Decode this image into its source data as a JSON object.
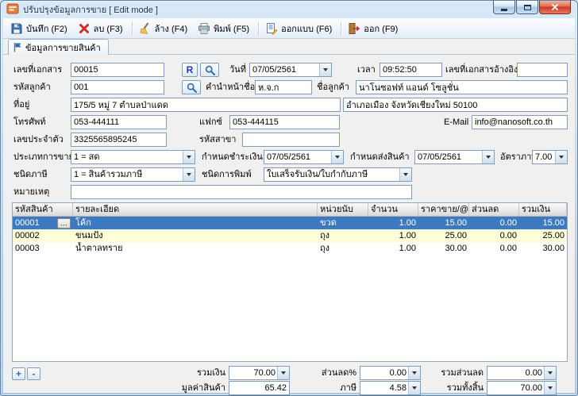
{
  "window": {
    "title": "ปรับปรุงข้อมูลการขาย [ Edit mode ]"
  },
  "colors": {
    "titlebar": "#b4cfe9",
    "selected_row": "#3d79c0",
    "alt_row": "#ffffd8",
    "close_button": "#c93a20",
    "accent_blue": "#2f6db2"
  },
  "toolbar": {
    "buttons": [
      {
        "label": "บันทึก (F2)",
        "icon": "save-icon"
      },
      {
        "label": "ลบ (F3)",
        "icon": "delete-icon"
      },
      {
        "label": "ล้าง (F4)",
        "icon": "clear-icon"
      },
      {
        "label": "พิมพ์ (F5)",
        "icon": "print-icon"
      },
      {
        "label": "ออกแบบ (F6)",
        "icon": "design-icon"
      },
      {
        "label": "ออก (F9)",
        "icon": "exit-icon"
      }
    ]
  },
  "tabs": [
    {
      "label": "ข้อมูลการขายสินค้า"
    }
  ],
  "form": {
    "doc_no": {
      "label": "เลขที่เอกสาร",
      "value": "00015"
    },
    "r_button": "R",
    "date": {
      "label": "วันที่",
      "value": "07/05/2561"
    },
    "time": {
      "label": "เวลา",
      "value": "09:52:50"
    },
    "ref_doc": {
      "label": "เลขที่เอกสารอ้างอิง",
      "value": ""
    },
    "customer_code": {
      "label": "รหัสลูกค้า",
      "value": "001"
    },
    "name_prefix": {
      "label": "คำนำหน้าชื่อ",
      "value": "ห.จ.ก"
    },
    "customer_name": {
      "label": "ชื่อลูกค้า",
      "value": "นาโนซอฟท์ แอนด์ โซลูชั่น"
    },
    "address": {
      "label": "ที่อยู่",
      "value1": "175/5 หมู่ 7 ตำบลป่าแดด",
      "value2": "อำเภอเมือง จังหวัดเชียงใหม่ 50100"
    },
    "phone": {
      "label": "โทรศัพท์",
      "value": "053-444111"
    },
    "fax": {
      "label": "แฟกซ์",
      "value": "053-444115"
    },
    "email": {
      "label": "E-Mail",
      "value": "info@nanosoft.co.th"
    },
    "tax_id": {
      "label": "เลขประจำตัว",
      "value": "3325565895245"
    },
    "branch_code": {
      "label": "รหัสสาขา",
      "value": ""
    },
    "sale_type": {
      "label": "ประเภทการขาย",
      "value": "1 = สด"
    },
    "payment_due": {
      "label": "กำหนดชำระเงิน",
      "value": "07/05/2561"
    },
    "delivery_date": {
      "label": "กำหนดส่งสินค้า",
      "value": "07/05/2561"
    },
    "tax_rate": {
      "label": "อัตราภาษี",
      "value": "7.00"
    },
    "tax_type": {
      "label": "ชนิดภาษี",
      "value": "1 = สินค้ารวมภาษี"
    },
    "print_type": {
      "label": "ชนิดการพิมพ์",
      "value": "ใบเสร็จรับเงิน/ใบกำกับภาษี"
    },
    "remark": {
      "label": "หมายเหตุ",
      "value": ""
    }
  },
  "grid": {
    "columns": [
      "รหัสสินค้า",
      "รายละเอียด",
      "หน่วยนับ",
      "จำนวน",
      "ราคาขาย/@",
      "ส่วนลด",
      "รวมเงิน"
    ],
    "rows": [
      [
        "00001",
        "โค้ก",
        "ขวด",
        "1.00",
        "15.00",
        "0.00",
        "15.00"
      ],
      [
        "00002",
        "ขนมปัง",
        "ถุง",
        "1.00",
        "25.00",
        "0.00",
        "25.00"
      ],
      [
        "00003",
        "น้ำตาลทราย",
        "ถุง",
        "1.00",
        "30.00",
        "0.00",
        "30.00"
      ]
    ]
  },
  "row_buttons": {
    "add": "+",
    "remove": "-",
    "ellipsis": "…"
  },
  "summary": {
    "total_amount": {
      "label": "รวมเงิน",
      "value": "70.00"
    },
    "discount_percent": {
      "label": "ส่วนลด%",
      "value": "0.00"
    },
    "total_discount": {
      "label": "รวมส่วนลด",
      "value": "0.00"
    },
    "goods_value": {
      "label": "มูลค่าสินค้า",
      "value": "65.42"
    },
    "tax": {
      "label": "ภาษี",
      "value": "4.58"
    },
    "grand_total": {
      "label": "รวมทั้งสิ้น",
      "value": "70.00"
    }
  }
}
